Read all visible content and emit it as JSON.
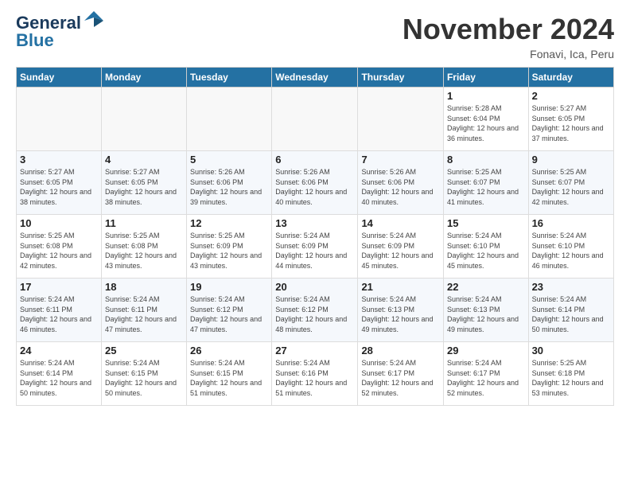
{
  "header": {
    "logo_line1": "General",
    "logo_line2": "Blue",
    "month": "November 2024",
    "location": "Fonavi, Ica, Peru"
  },
  "weekdays": [
    "Sunday",
    "Monday",
    "Tuesday",
    "Wednesday",
    "Thursday",
    "Friday",
    "Saturday"
  ],
  "weeks": [
    [
      {
        "day": "",
        "info": ""
      },
      {
        "day": "",
        "info": ""
      },
      {
        "day": "",
        "info": ""
      },
      {
        "day": "",
        "info": ""
      },
      {
        "day": "",
        "info": ""
      },
      {
        "day": "1",
        "info": "Sunrise: 5:28 AM\nSunset: 6:04 PM\nDaylight: 12 hours and 36 minutes."
      },
      {
        "day": "2",
        "info": "Sunrise: 5:27 AM\nSunset: 6:05 PM\nDaylight: 12 hours and 37 minutes."
      }
    ],
    [
      {
        "day": "3",
        "info": "Sunrise: 5:27 AM\nSunset: 6:05 PM\nDaylight: 12 hours and 38 minutes."
      },
      {
        "day": "4",
        "info": "Sunrise: 5:27 AM\nSunset: 6:05 PM\nDaylight: 12 hours and 38 minutes."
      },
      {
        "day": "5",
        "info": "Sunrise: 5:26 AM\nSunset: 6:06 PM\nDaylight: 12 hours and 39 minutes."
      },
      {
        "day": "6",
        "info": "Sunrise: 5:26 AM\nSunset: 6:06 PM\nDaylight: 12 hours and 40 minutes."
      },
      {
        "day": "7",
        "info": "Sunrise: 5:26 AM\nSunset: 6:06 PM\nDaylight: 12 hours and 40 minutes."
      },
      {
        "day": "8",
        "info": "Sunrise: 5:25 AM\nSunset: 6:07 PM\nDaylight: 12 hours and 41 minutes."
      },
      {
        "day": "9",
        "info": "Sunrise: 5:25 AM\nSunset: 6:07 PM\nDaylight: 12 hours and 42 minutes."
      }
    ],
    [
      {
        "day": "10",
        "info": "Sunrise: 5:25 AM\nSunset: 6:08 PM\nDaylight: 12 hours and 42 minutes."
      },
      {
        "day": "11",
        "info": "Sunrise: 5:25 AM\nSunset: 6:08 PM\nDaylight: 12 hours and 43 minutes."
      },
      {
        "day": "12",
        "info": "Sunrise: 5:25 AM\nSunset: 6:09 PM\nDaylight: 12 hours and 43 minutes."
      },
      {
        "day": "13",
        "info": "Sunrise: 5:24 AM\nSunset: 6:09 PM\nDaylight: 12 hours and 44 minutes."
      },
      {
        "day": "14",
        "info": "Sunrise: 5:24 AM\nSunset: 6:09 PM\nDaylight: 12 hours and 45 minutes."
      },
      {
        "day": "15",
        "info": "Sunrise: 5:24 AM\nSunset: 6:10 PM\nDaylight: 12 hours and 45 minutes."
      },
      {
        "day": "16",
        "info": "Sunrise: 5:24 AM\nSunset: 6:10 PM\nDaylight: 12 hours and 46 minutes."
      }
    ],
    [
      {
        "day": "17",
        "info": "Sunrise: 5:24 AM\nSunset: 6:11 PM\nDaylight: 12 hours and 46 minutes."
      },
      {
        "day": "18",
        "info": "Sunrise: 5:24 AM\nSunset: 6:11 PM\nDaylight: 12 hours and 47 minutes."
      },
      {
        "day": "19",
        "info": "Sunrise: 5:24 AM\nSunset: 6:12 PM\nDaylight: 12 hours and 47 minutes."
      },
      {
        "day": "20",
        "info": "Sunrise: 5:24 AM\nSunset: 6:12 PM\nDaylight: 12 hours and 48 minutes."
      },
      {
        "day": "21",
        "info": "Sunrise: 5:24 AM\nSunset: 6:13 PM\nDaylight: 12 hours and 49 minutes."
      },
      {
        "day": "22",
        "info": "Sunrise: 5:24 AM\nSunset: 6:13 PM\nDaylight: 12 hours and 49 minutes."
      },
      {
        "day": "23",
        "info": "Sunrise: 5:24 AM\nSunset: 6:14 PM\nDaylight: 12 hours and 50 minutes."
      }
    ],
    [
      {
        "day": "24",
        "info": "Sunrise: 5:24 AM\nSunset: 6:14 PM\nDaylight: 12 hours and 50 minutes."
      },
      {
        "day": "25",
        "info": "Sunrise: 5:24 AM\nSunset: 6:15 PM\nDaylight: 12 hours and 50 minutes."
      },
      {
        "day": "26",
        "info": "Sunrise: 5:24 AM\nSunset: 6:15 PM\nDaylight: 12 hours and 51 minutes."
      },
      {
        "day": "27",
        "info": "Sunrise: 5:24 AM\nSunset: 6:16 PM\nDaylight: 12 hours and 51 minutes."
      },
      {
        "day": "28",
        "info": "Sunrise: 5:24 AM\nSunset: 6:17 PM\nDaylight: 12 hours and 52 minutes."
      },
      {
        "day": "29",
        "info": "Sunrise: 5:24 AM\nSunset: 6:17 PM\nDaylight: 12 hours and 52 minutes."
      },
      {
        "day": "30",
        "info": "Sunrise: 5:25 AM\nSunset: 6:18 PM\nDaylight: 12 hours and 53 minutes."
      }
    ]
  ]
}
